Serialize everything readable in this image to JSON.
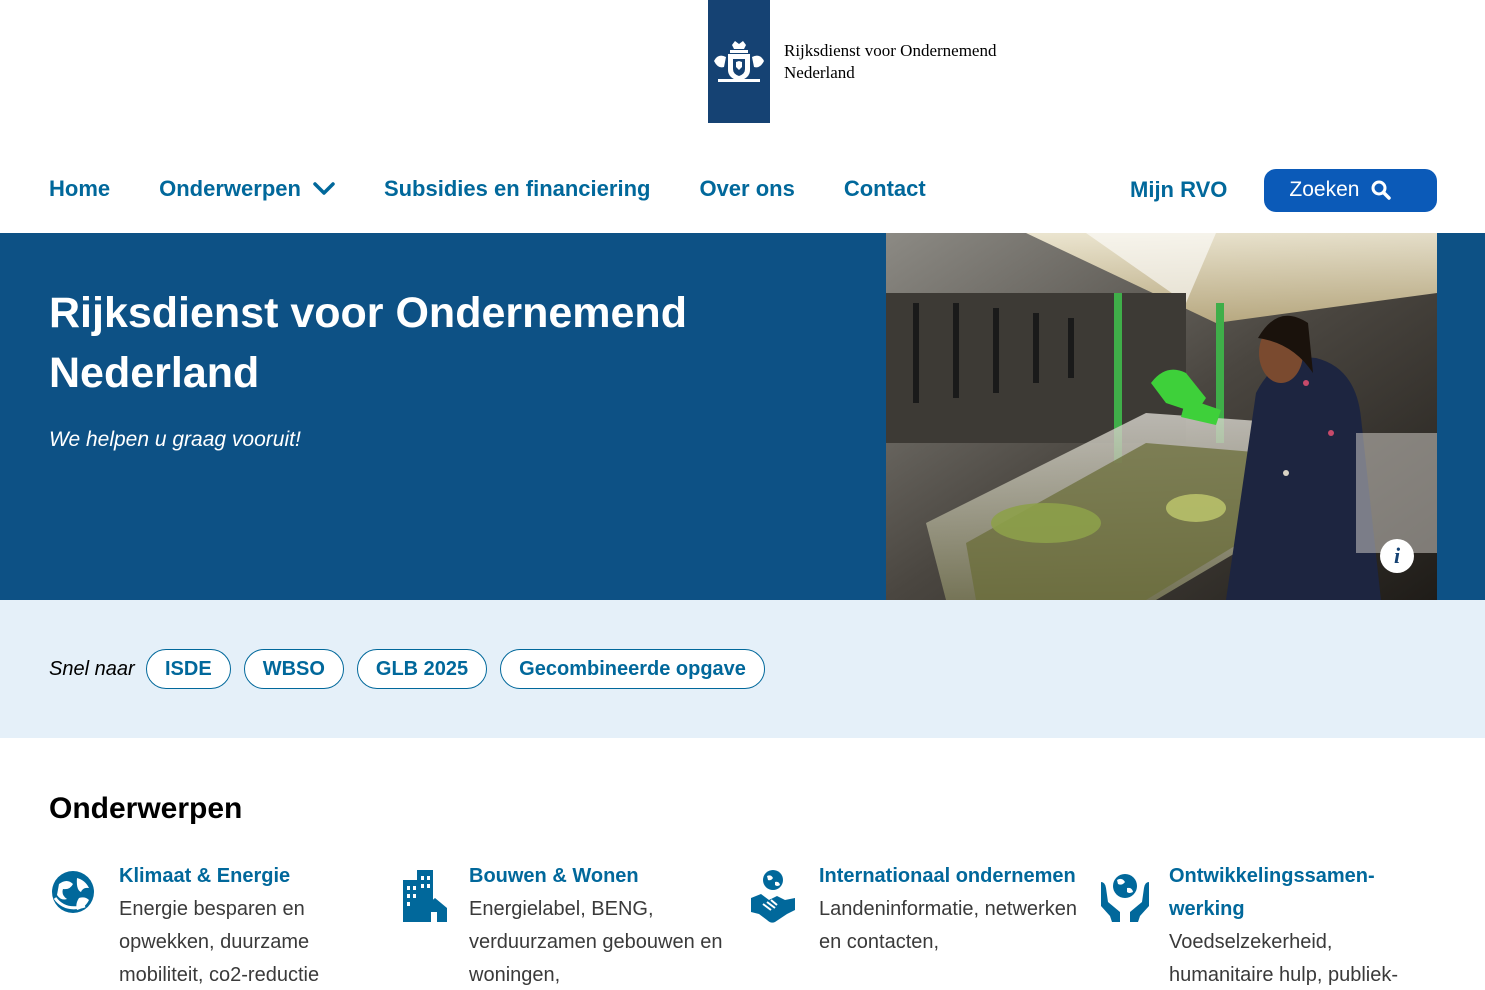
{
  "header": {
    "logo_line1": "Rijksdienst voor Ondernemend",
    "logo_line2": "Nederland"
  },
  "nav": {
    "items": [
      {
        "label": "Home"
      },
      {
        "label": "Onderwerpen"
      },
      {
        "label": "Subsidies en financiering"
      },
      {
        "label": "Over ons"
      },
      {
        "label": "Contact"
      }
    ],
    "mijn_rvo": "Mijn RVO",
    "search_label": "Zoeken"
  },
  "hero": {
    "title": "Rijksdienst voor Ondernemend Nederland",
    "subtitle": "We helpen u graag vooruit!",
    "info_glyph": "i"
  },
  "quicklinks": {
    "label": "Snel naar",
    "items": [
      "ISDE",
      "WBSO",
      "GLB 2025",
      "Gecombineerde opgave"
    ]
  },
  "topics": {
    "heading": "Onderwerpen",
    "items": [
      {
        "title": "Klimaat & Energie",
        "desc": "Energie besparen en opwekken, duurzame mobiliteit, co2-reductie",
        "icon": "globe-icon"
      },
      {
        "title": "Bouwen & Wonen",
        "desc": "Energielabel, BENG, verduurzamen gebouwen en woningen,",
        "icon": "buildings-icon"
      },
      {
        "title": "Internationaal ondernemen",
        "desc": "Landeninformatie, netwerken en contacten,",
        "icon": "handshake-globe-icon"
      },
      {
        "title": "Ontwikkelingssamen-werking",
        "desc": "Voedselzekerheid, humanitaire hulp, publiek-",
        "icon": "hands-globe-icon"
      }
    ]
  },
  "colors": {
    "brand_dark": "#154273",
    "link": "#01689b",
    "hero_bg": "#0d5185",
    "search_bg": "#0b5ab8",
    "quicklinks_bg": "#e5f0f9"
  }
}
